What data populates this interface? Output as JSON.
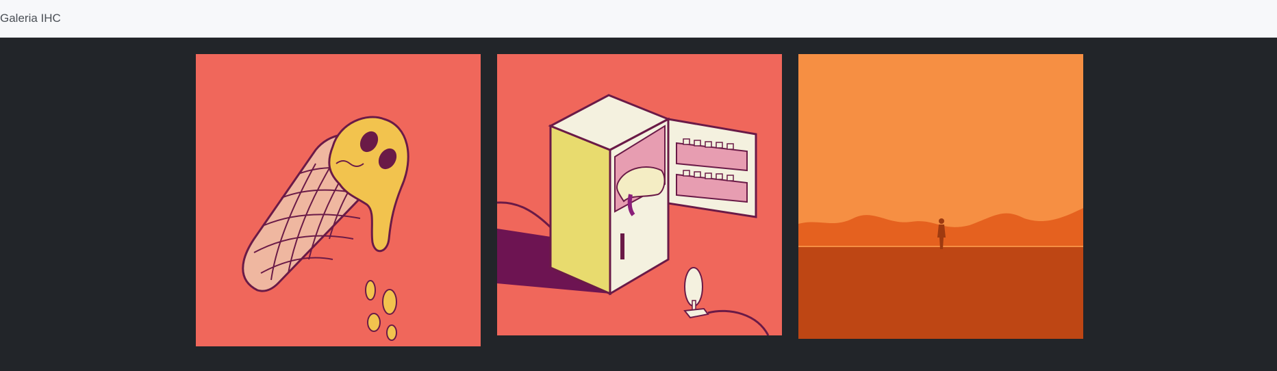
{
  "navbar": {
    "brand": "Galeria IHC"
  },
  "gallery": {
    "images": [
      {
        "name": "melting-ice-cream-cone",
        "background": "#f0675b"
      },
      {
        "name": "dog-in-fridge",
        "background": "#f0675b"
      },
      {
        "name": "desert-silhouette",
        "background": "#f68f43"
      }
    ]
  },
  "colors": {
    "navbar_bg": "#f7f8fa",
    "page_bg": "#222529",
    "outline": "#6a1a47",
    "yellow": "#f2c34e",
    "cone": "#efb7a0"
  }
}
